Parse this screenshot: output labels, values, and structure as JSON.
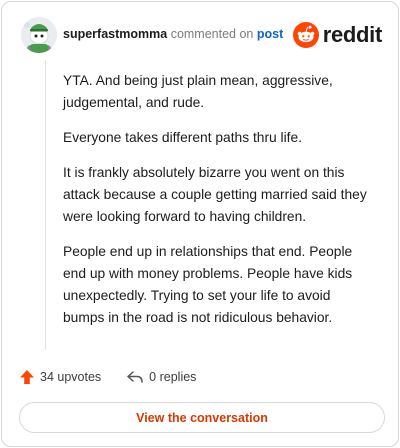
{
  "header": {
    "username": "superfastmomma",
    "action": "commented on",
    "target": "post",
    "brand": "reddit"
  },
  "comment": {
    "paragraphs": [
      "YTA. And being just plain mean, aggressive, judgemental, and rude.",
      "Everyone takes different paths thru life.",
      "It is frankly absolutely bizarre you went on this attack because a couple getting married said they were looking forward to having children.",
      "People end up in relationships that end. People end up with money problems. People have kids unexpectedly. Trying to set your life to avoid bumps in the road is not ridiculous behavior."
    ]
  },
  "stats": {
    "upvotes": "34 upvotes",
    "replies": "0 replies"
  },
  "cta": {
    "label": "View the conversation"
  },
  "colors": {
    "brand_orange": "#ff4500",
    "link_blue": "#0a66c2",
    "cta_text": "#d93900"
  }
}
